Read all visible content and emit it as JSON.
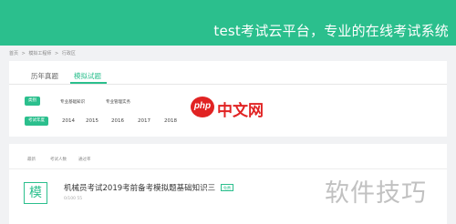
{
  "banner": {
    "title": "test考试云平台，专业的在线考试系统"
  },
  "breadcrumb": [
    "首页",
    ">",
    "模拟工程师",
    ">",
    "行政区"
  ],
  "tabs": [
    {
      "label": "历年真题"
    },
    {
      "label": "模拟试题"
    }
  ],
  "filters": {
    "row1_label": "类别",
    "row1_options": [
      "专业基础知识",
      "专业管理实务"
    ],
    "row2_label": "考试年度",
    "years": [
      "2014",
      "2015",
      "2016",
      "2017",
      "2018"
    ]
  },
  "sort": [
    "最新",
    "考试人数",
    "通过率"
  ],
  "exam": {
    "icon_char": "模",
    "title": "机械员考试2019考前备考模拟题基础知识三",
    "badge": "免费",
    "meta": "0/100    55"
  },
  "watermarks": {
    "php_icon": "php",
    "php_text": "中文网",
    "corner": "软件技巧"
  },
  "colors": {
    "accent": "#2bbf8d",
    "php_red": "#e12323"
  }
}
